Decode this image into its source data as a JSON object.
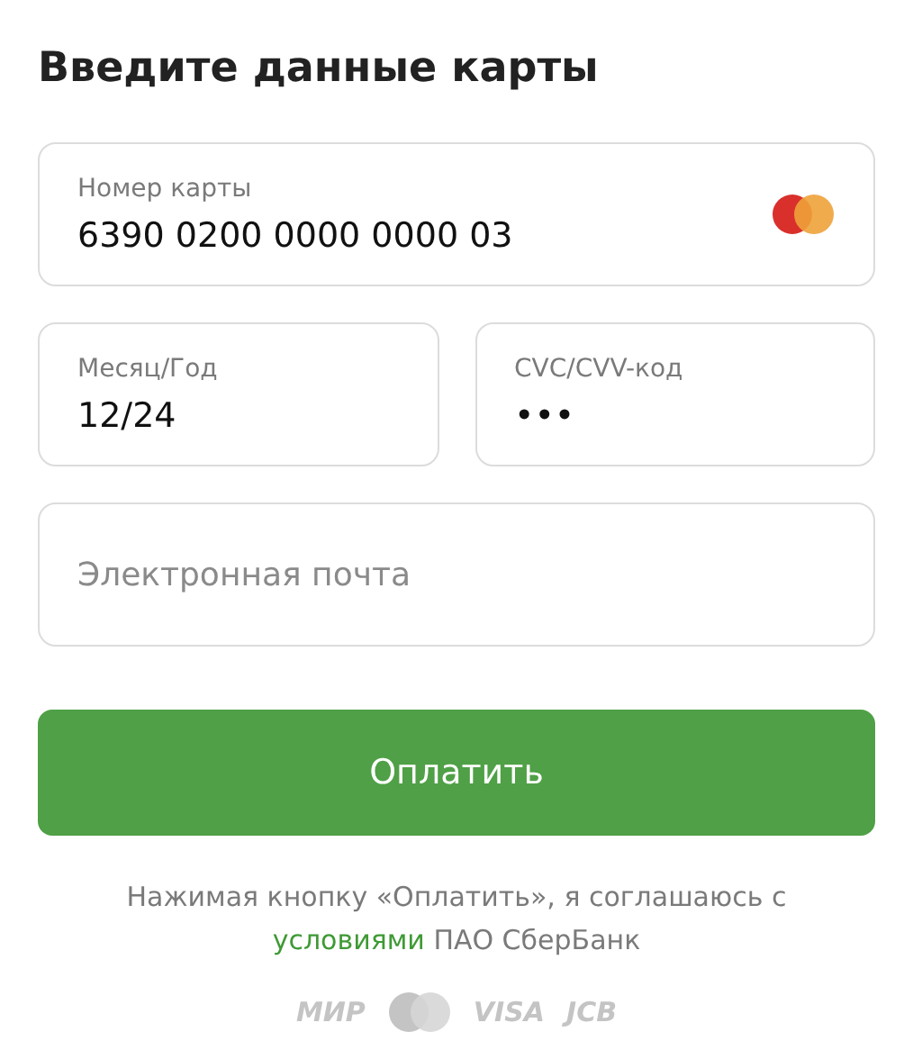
{
  "title": "Введите данные карты",
  "card_number": {
    "label": "Номер карты",
    "value": "6390 0200 0000 0000 03"
  },
  "expiry": {
    "label": "Месяц/Год",
    "value": "12/24"
  },
  "cvc": {
    "label": "CVC/CVV-код",
    "value": "•••"
  },
  "email": {
    "placeholder": "Электронная почта"
  },
  "pay_button": "Оплатить",
  "agreement": {
    "before": "Нажимая кнопку «Оплатить», я соглашаюсь с ",
    "link": "условиями",
    "after": " ПАО СберБанк"
  },
  "payment_logos": [
    {
      "kind": "text",
      "text": "МИР"
    },
    {
      "kind": "circles"
    },
    {
      "kind": "text",
      "text": "VISA"
    },
    {
      "kind": "text",
      "text": "JCB"
    }
  ]
}
